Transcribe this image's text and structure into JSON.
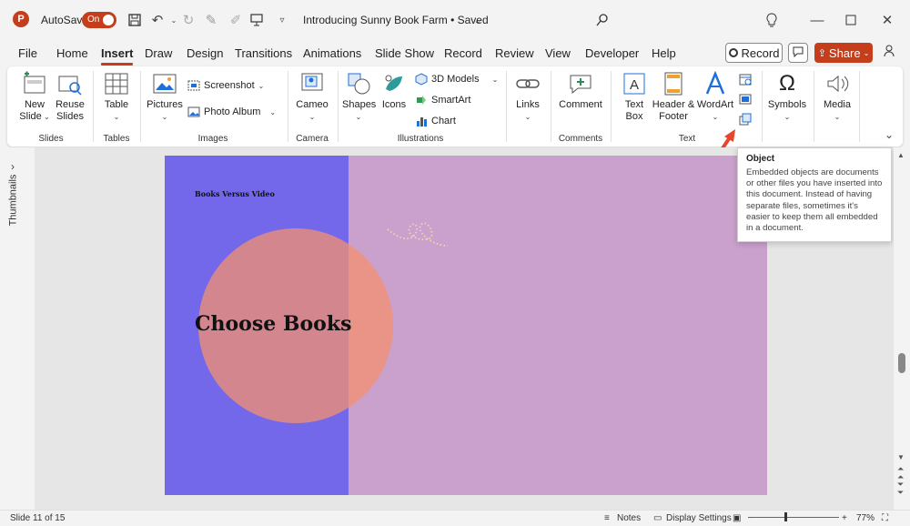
{
  "titlebar": {
    "app_letter": "P",
    "autosave_label": "AutoSave",
    "autosave_state": "On",
    "document_title": "Introducing Sunny Book Farm • Saved"
  },
  "tabs": [
    "File",
    "Home",
    "Insert",
    "Draw",
    "Design",
    "Transitions",
    "Animations",
    "Slide Show",
    "Record",
    "Review",
    "View",
    "Developer",
    "Help"
  ],
  "active_tab": "Insert",
  "header_buttons": {
    "record": "Record",
    "share": "Share"
  },
  "ribbon": {
    "slides": {
      "new_slide": "New Slide",
      "reuse_slides": "Reuse Slides",
      "group": "Slides"
    },
    "tables": {
      "table": "Table",
      "group": "Tables"
    },
    "images": {
      "pictures": "Pictures",
      "screenshot": "Screenshot",
      "photo_album": "Photo Album",
      "group": "Images"
    },
    "camera": {
      "cameo": "Cameo",
      "group": "Camera"
    },
    "illustrations": {
      "shapes": "Shapes",
      "icons": "Icons",
      "models_3d": "3D Models",
      "smartart": "SmartArt",
      "chart": "Chart",
      "group": "Illustrations"
    },
    "links": {
      "links": "Links"
    },
    "comments": {
      "comment": "Comment",
      "group": "Comments"
    },
    "text": {
      "text_box": "Text Box",
      "header_footer": "Header & Footer",
      "wordart": "WordArt",
      "group": "Text"
    },
    "symbols": {
      "symbols": "Symbols"
    },
    "media": {
      "media": "Media"
    }
  },
  "thumbnails_label": "Thumbnails",
  "slide": {
    "small_title": "Books Versus Video",
    "big_title": "Choose Books",
    "left_color": "#7468ea",
    "right_color": "#c9a1cc",
    "circle_color": "#f49070"
  },
  "tooltip": {
    "title": "Object",
    "body": "Embedded objects are documents or other files you have inserted into this document. Instead of having separate files, sometimes it's easier to keep them all embedded in a document."
  },
  "statusbar": {
    "slide_counter": "Slide 11 of 15",
    "notes": "Notes",
    "display_settings": "Display Settings",
    "zoom": "77%"
  },
  "colors": {
    "accent": "#c43e1c"
  }
}
